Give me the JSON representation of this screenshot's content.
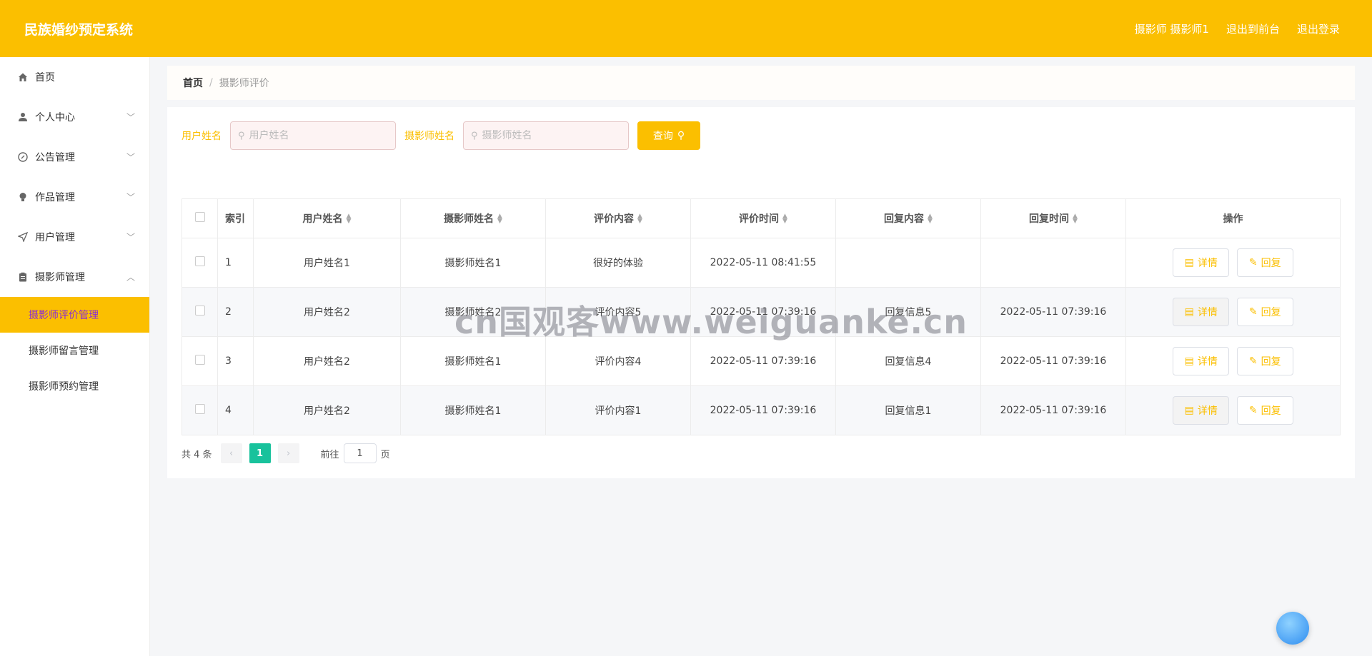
{
  "header": {
    "title": "民族婚纱预定系统",
    "user_label": "摄影师 摄影师1",
    "to_front_label": "退出到前台",
    "logout_label": "退出登录"
  },
  "sidebar": {
    "items": [
      {
        "label": "首页",
        "icon": "home-icon"
      },
      {
        "label": "个人中心",
        "icon": "user-icon"
      },
      {
        "label": "公告管理",
        "icon": "compass-icon"
      },
      {
        "label": "作品管理",
        "icon": "bulb-icon"
      },
      {
        "label": "用户管理",
        "icon": "send-icon"
      },
      {
        "label": "摄影师管理",
        "icon": "clipboard-icon"
      }
    ],
    "submenu": [
      {
        "label": "摄影师评价管理",
        "active": true
      },
      {
        "label": "摄影师留言管理",
        "active": false
      },
      {
        "label": "摄影师预约管理",
        "active": false
      }
    ]
  },
  "breadcrumb": {
    "home": "首页",
    "separator": "/",
    "current": "摄影师评价"
  },
  "search": {
    "user_label": "用户姓名",
    "user_placeholder": "用户姓名",
    "photographer_label": "摄影师姓名",
    "photographer_placeholder": "摄影师姓名",
    "query_label": "查询"
  },
  "table": {
    "headers": [
      "索引",
      "用户姓名",
      "摄影师姓名",
      "评价内容",
      "评价时间",
      "回复内容",
      "回复时间",
      "操作"
    ],
    "rows": [
      {
        "idx": "1",
        "user": "用户姓名1",
        "photographer": "摄影师姓名1",
        "content": "很好的体验",
        "time": "2022-05-11 08:41:55",
        "reply": "",
        "reply_time": ""
      },
      {
        "idx": "2",
        "user": "用户姓名2",
        "photographer": "摄影师姓名2",
        "content": "评价内容5",
        "time": "2022-05-11 07:39:16",
        "reply": "回复信息5",
        "reply_time": "2022-05-11 07:39:16"
      },
      {
        "idx": "3",
        "user": "用户姓名2",
        "photographer": "摄影师姓名1",
        "content": "评价内容4",
        "time": "2022-05-11 07:39:16",
        "reply": "回复信息4",
        "reply_time": "2022-05-11 07:39:16"
      },
      {
        "idx": "4",
        "user": "用户姓名2",
        "photographer": "摄影师姓名1",
        "content": "评价内容1",
        "time": "2022-05-11 07:39:16",
        "reply": "回复信息1",
        "reply_time": "2022-05-11 07:39:16"
      }
    ],
    "detail_label": "详情",
    "reply_label": "回复"
  },
  "pager": {
    "total": "共 4 条",
    "current": "1",
    "goto": "前往",
    "page_value": "1",
    "page_suffix": "页"
  },
  "watermark": "cn国观客www.weiguanke.cn",
  "colors": {
    "accent": "#fbbf00",
    "active_text": "#8b2bd6",
    "pager_active": "#18c29c"
  }
}
